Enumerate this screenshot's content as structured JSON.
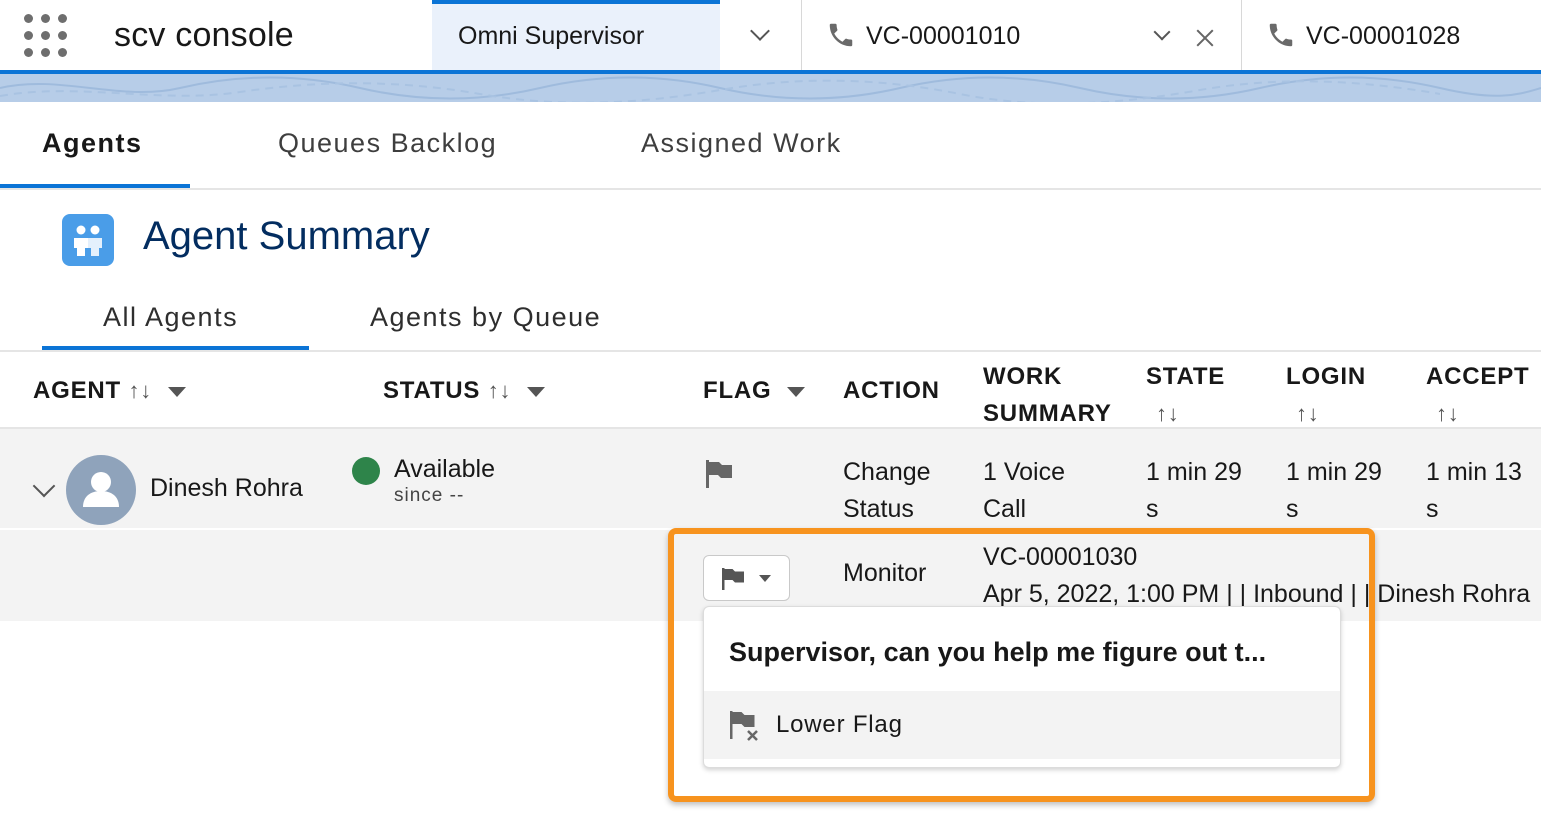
{
  "topbar": {
    "app_name": "scv console",
    "tabs": [
      {
        "label": "Omni Supervisor",
        "icon": ""
      },
      {
        "label": "VC-00001010",
        "icon": "phone-icon"
      },
      {
        "label": "VC-00001028",
        "icon": "phone-icon"
      }
    ]
  },
  "main_tabs": [
    "Agents",
    "Queues Backlog",
    "Assigned Work"
  ],
  "page_title": "Agent Summary",
  "sub_tabs": [
    "All Agents",
    "Agents by Queue"
  ],
  "table": {
    "headers": {
      "agent": "AGENT",
      "status": "STATUS",
      "flag": "FLAG",
      "action": "ACTION",
      "work_summary_1": "WORK",
      "work_summary_2": "SUMMARY",
      "state": "STATE",
      "login": "LOGIN",
      "accept": "ACCEPT"
    },
    "sort_glyph": "↑↓",
    "row": {
      "agent_name": "Dinesh Rohra",
      "status": "Available",
      "since": "since  --",
      "action_1": "Change",
      "action_2": "Status",
      "work_1": "1 Voice",
      "work_2": "Call",
      "state_1": "1 min 29",
      "state_2": "s",
      "login_1": "1 min 29",
      "login_2": "s",
      "accept_1": "1 min 13",
      "accept_2": "s"
    },
    "subrow": {
      "action": "Monitor",
      "work_id": "VC-00001030",
      "work_detail": "Apr 5, 2022, 1:00 PM | | Inbound | | Dinesh Rohra"
    }
  },
  "flag_dropdown": {
    "message": "Supervisor, can you help me figure out t...",
    "item": "Lower Flag"
  },
  "colors": {
    "brand": "#0b74d6",
    "link": "#0b5cab",
    "status_available": "#2e844a",
    "highlight": "#f7931e"
  }
}
